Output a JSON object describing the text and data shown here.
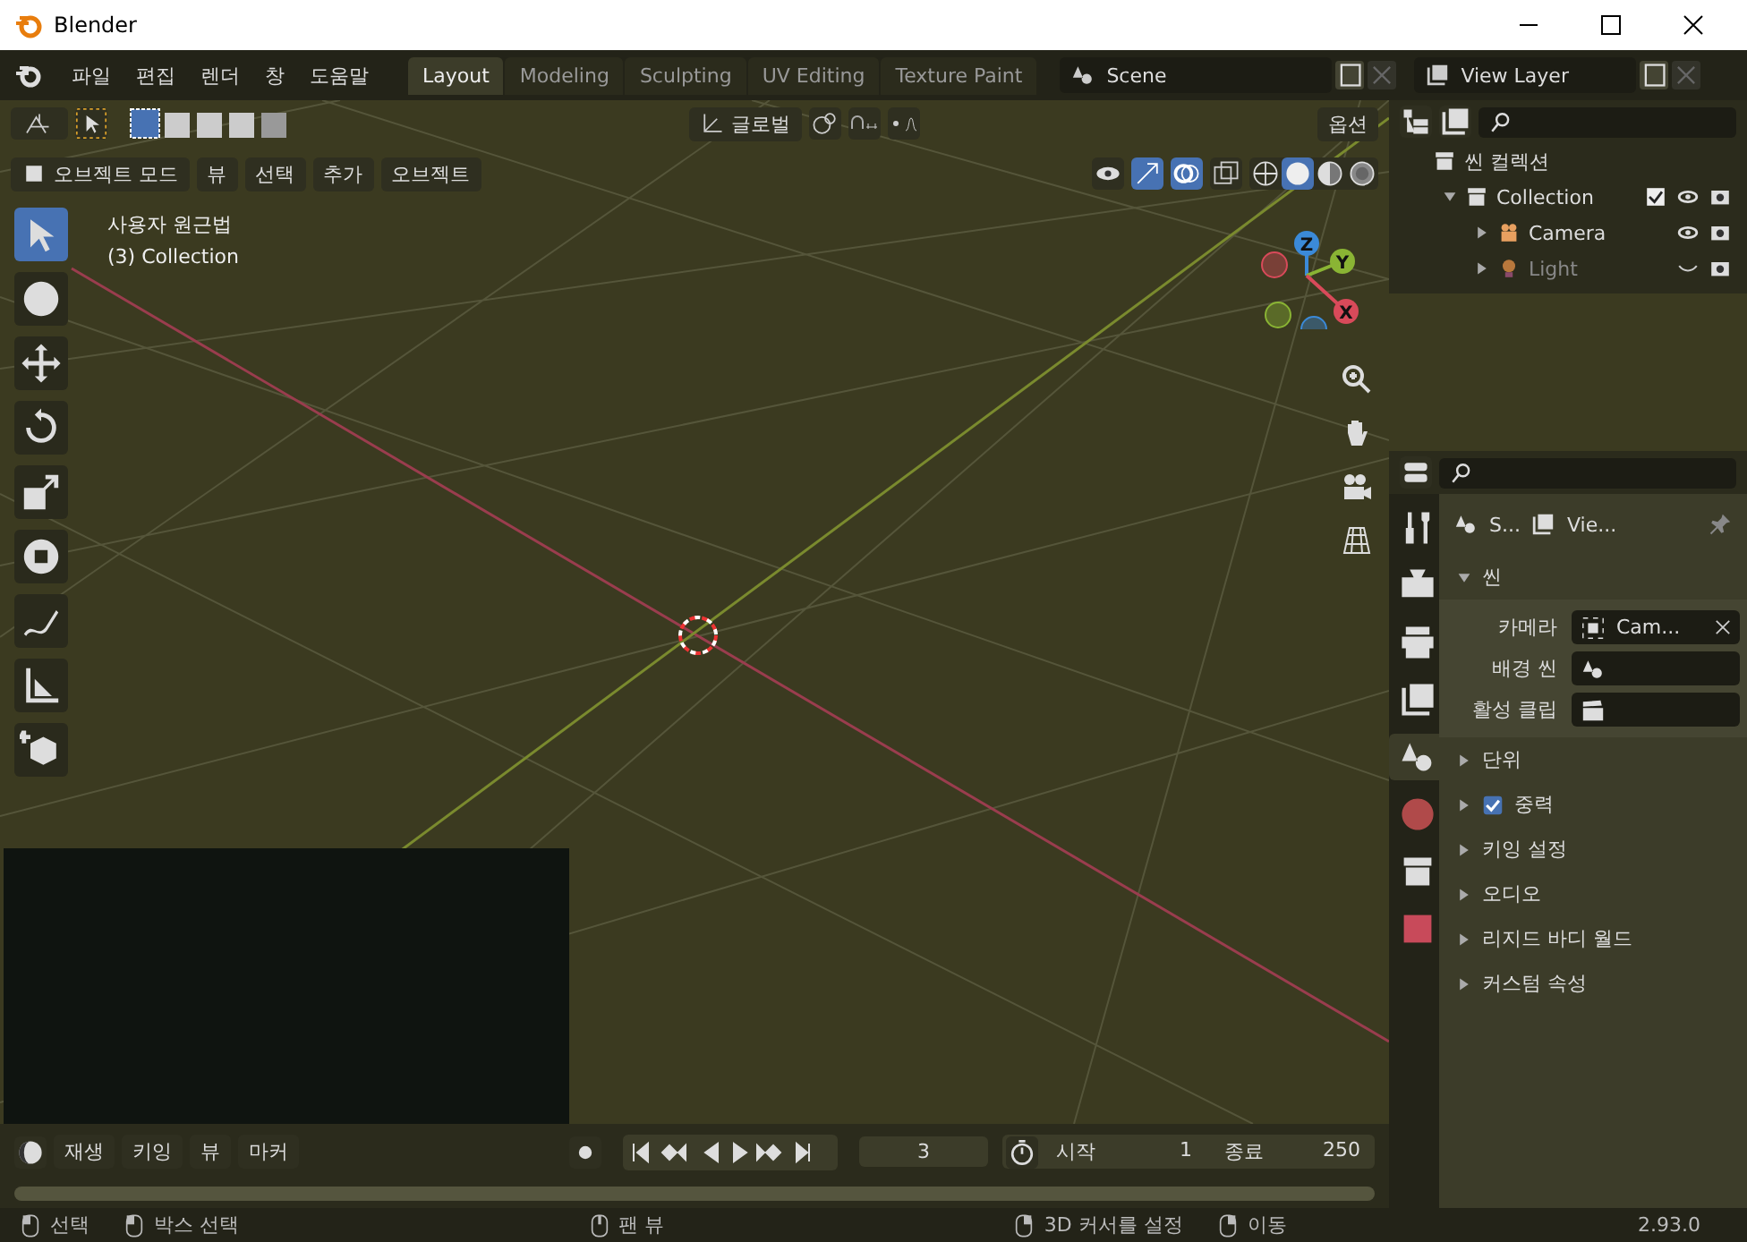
{
  "window": {
    "title": "Blender"
  },
  "menu": [
    "파일",
    "편집",
    "렌더",
    "창",
    "도움말"
  ],
  "workspaces": [
    {
      "label": "Layout",
      "selected": true
    },
    {
      "label": "Modeling",
      "selected": false
    },
    {
      "label": "Sculpting",
      "selected": false
    },
    {
      "label": "UV Editing",
      "selected": false
    },
    {
      "label": "Texture Paint",
      "selected": false
    }
  ],
  "scene": {
    "value": "Scene"
  },
  "view_layer": {
    "value": "View Layer"
  },
  "viewport": {
    "orientation": "글로벌",
    "options": "옵션",
    "mode": "오브젝트 모드",
    "menus": [
      "뷰",
      "선택",
      "추가",
      "오브젝트"
    ],
    "overlay_text": [
      "사용자 원근법",
      "(3) Collection"
    ],
    "shading": [
      {
        "kind": "wire",
        "selected": false
      },
      {
        "kind": "solid",
        "selected": true
      },
      {
        "kind": "material",
        "selected": false
      },
      {
        "kind": "rendered",
        "selected": false
      }
    ],
    "gizmo": [
      {
        "label": "Z",
        "color": "#3b8ad8"
      },
      {
        "label": "Y",
        "color": "#8ab434"
      },
      {
        "label": "X",
        "color": "#d84a5a"
      }
    ],
    "tools": [
      {
        "kind": "select-box",
        "selected": true
      },
      {
        "kind": "cursor",
        "selected": false
      },
      {
        "kind": "move",
        "selected": false
      },
      {
        "kind": "rotate",
        "selected": false
      },
      {
        "kind": "scale",
        "selected": false
      },
      {
        "kind": "transform",
        "selected": false
      },
      {
        "kind": "annotate",
        "selected": false
      },
      {
        "kind": "measure",
        "selected": false
      },
      {
        "kind": "add-cube",
        "selected": false
      }
    ]
  },
  "outliner": {
    "root": "씬 컬렉션",
    "items": [
      {
        "label": "Collection",
        "expanded": true,
        "checked": true,
        "children": [
          {
            "label": "Camera",
            "kind": "camera",
            "expanded": false,
            "hidden": false
          },
          {
            "label": "Light",
            "kind": "light",
            "expanded": false,
            "hidden": true
          }
        ]
      }
    ]
  },
  "properties": {
    "tabs": [
      {
        "kind": "tool",
        "selected": false
      },
      {
        "kind": "render",
        "selected": false
      },
      {
        "kind": "output",
        "selected": false
      },
      {
        "kind": "view-layer",
        "selected": false
      },
      {
        "kind": "scene",
        "selected": true
      },
      {
        "kind": "world",
        "selected": false
      },
      {
        "kind": "collection",
        "selected": false
      },
      {
        "kind": "texture",
        "selected": false
      }
    ],
    "context": [
      "S...",
      "Vie..."
    ],
    "panel": {
      "title": "씬",
      "expanded": true,
      "fields": [
        {
          "label": "카메라",
          "kind": "object",
          "value": "Cam..."
        },
        {
          "label": "배경 씬",
          "kind": "scene"
        },
        {
          "label": "활성 클립",
          "kind": "clip"
        }
      ]
    },
    "sections": [
      {
        "label": "단위",
        "expanded": false
      },
      {
        "label": "중력",
        "expanded": false,
        "checked": true
      },
      {
        "label": "키잉 설정",
        "expanded": false
      },
      {
        "label": "오디오",
        "expanded": false
      },
      {
        "label": "리지드 바디 월드",
        "expanded": false
      },
      {
        "label": "커스텀 속성",
        "expanded": false
      }
    ]
  },
  "timeline": {
    "menus": [
      "재생",
      "키잉",
      "뷰",
      "마커"
    ],
    "frame": "3",
    "start_label": "시작",
    "start": "1",
    "end_label": "종료",
    "end": "250"
  },
  "status": {
    "hints": [
      {
        "label": "선택"
      },
      {
        "label": "박스 선택"
      },
      {
        "label": "팬 뷰"
      },
      {
        "label": "3D 커서를 설정"
      },
      {
        "label": "이동"
      }
    ],
    "version": "2.93.0"
  }
}
